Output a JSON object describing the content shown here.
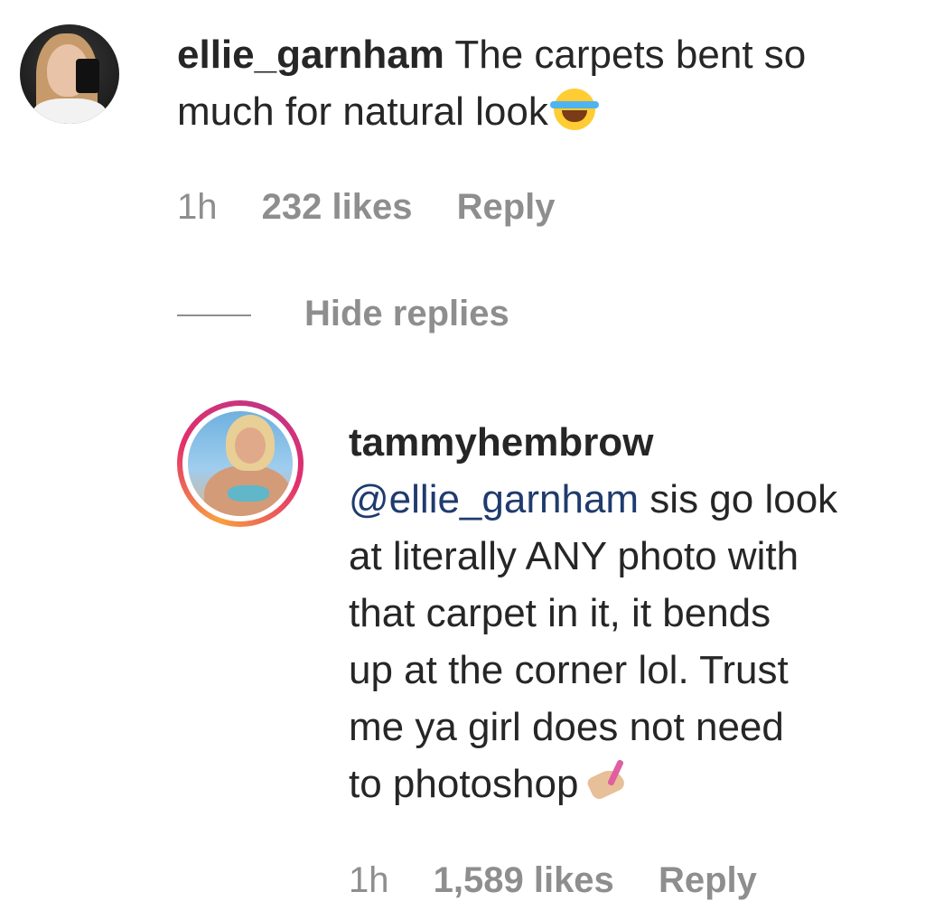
{
  "comments": [
    {
      "username": "ellie_garnham",
      "text_line1": "The carpets bent so",
      "text_line2": "much for natural look",
      "emoji": "face-with-tears-of-joy",
      "time": "1h",
      "likes": "232 likes",
      "reply_label": "Reply"
    }
  ],
  "thread": {
    "hide_replies_label": "Hide replies"
  },
  "replies": [
    {
      "username": "tammyhembrow",
      "mention": "@ellie_garnham",
      "line1_rest": "sis go look",
      "line2": "at literally ANY photo with",
      "line3": "that carpet in it, it bends",
      "line4": "up at the corner lol. Trust",
      "line5": "me ya girl does not need",
      "line6": "to photoshop",
      "emoji": "nail-polish",
      "time": "1h",
      "likes": "1,589 likes",
      "reply_label": "Reply",
      "story_ring_colors": [
        "#f9a03f",
        "#e1306c",
        "#c13584"
      ]
    }
  ],
  "colors": {
    "text": "#262626",
    "meta": "#8e8e8e",
    "mention": "#1f3b6e"
  }
}
